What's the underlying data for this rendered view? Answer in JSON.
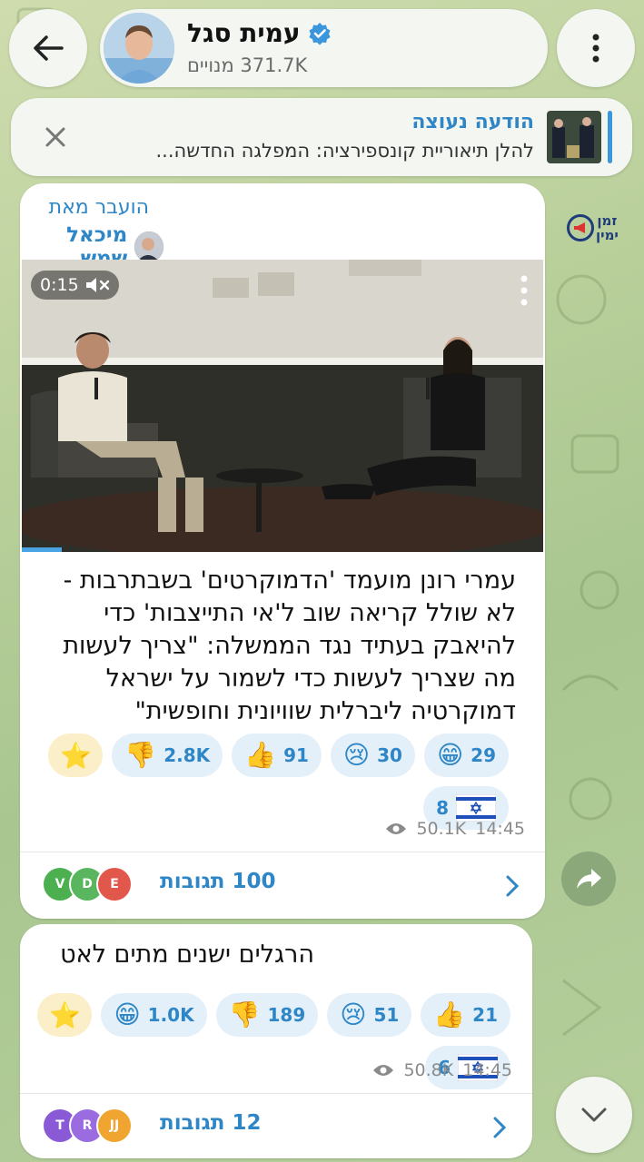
{
  "header": {
    "channel_name": "עמית סגל",
    "subscribers": "371.7K מנויים"
  },
  "pinned": {
    "title": "הודעה נעוצה",
    "text": "להלן תיאוריית קונספירציה: המפלגה החדשה..."
  },
  "side_logo": {
    "line1": "זמן",
    "line2": "ימין"
  },
  "post1": {
    "forwarded_label": "הועבר מאת",
    "forwarded_from": "מיכאל שמש",
    "video_time": "0:15",
    "text": "עמרי רונן מועמד 'הדמוקרטים' בשבתרבות - לא שולל קריאה שוב ל'אי התייצבות' כדי להיאבק בעתיד נגד הממשלה: \"צריך לעשות מה שצריך לעשות כדי לשמור על ישראל דמוקרטיה ליברלית שוויונית וחופשית\"",
    "reactions": [
      {
        "emoji": "⭐",
        "count": "",
        "kind": "star"
      },
      {
        "emoji": "👎",
        "count": "2.8K"
      },
      {
        "emoji": "👍",
        "count": "91"
      },
      {
        "emoji": "😢",
        "count": "30"
      },
      {
        "emoji": "😁",
        "count": "29"
      },
      {
        "emoji": "flag-il",
        "count": "8",
        "kind": "flag"
      }
    ],
    "views": "50.1K",
    "time": "14:45",
    "comments_label": "100 תגובות",
    "commenter_avatars": [
      "V",
      "D",
      "E"
    ]
  },
  "post2": {
    "text": "הרגלים ישנים מתים לאט",
    "reactions": [
      {
        "emoji": "⭐",
        "count": "",
        "kind": "star"
      },
      {
        "emoji": "😁",
        "count": "1.0K"
      },
      {
        "emoji": "👎",
        "count": "189"
      },
      {
        "emoji": "😢",
        "count": "51"
      },
      {
        "emoji": "👍",
        "count": "21"
      },
      {
        "emoji": "flag-il",
        "count": "6",
        "kind": "flag"
      }
    ],
    "views": "50.8K",
    "time": "14:45",
    "comments_label": "12 תגובות",
    "commenter_avatars": [
      "T",
      "R",
      "JJ"
    ]
  },
  "colors": {
    "accent": "#2e86c7",
    "reaction_bg": "#e3f0fa",
    "bubble_bg": "#ffffff",
    "av_v": "#4cb050",
    "av_d": "#5ab65e",
    "av_e": "#e2574c",
    "av_t": "#8a5ad6",
    "av_r": "#9b6be0",
    "av_jj": "#f0a530"
  }
}
